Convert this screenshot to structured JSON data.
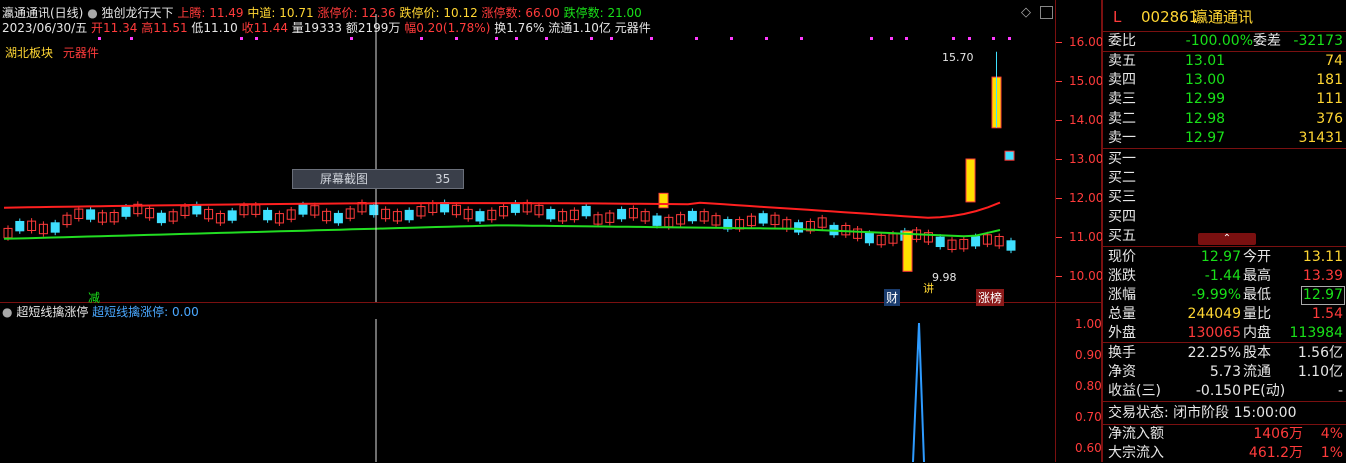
{
  "header": {
    "stock_name_period": "瀛通通讯(日线)",
    "indicator_name": "独创龙行天下",
    "upper_label": "上腾: 11.49",
    "mid_label": "中道: 10.71",
    "limit_up_label": "涨停价: 12.36",
    "limit_down_label": "跌停价: 10.12",
    "limit_up_count": "涨停数: 66.00",
    "limit_down_count": "跌停数: 21.00",
    "date": "2023/06/30/五",
    "open": "开11.34",
    "high": "高11.51",
    "low": "低11.10",
    "close": "收11.44",
    "volume": "量19333",
    "amount": "额2199万",
    "change": "幅0.20(1.78%)",
    "turnover": "换1.76%",
    "float": "流通1.10亿",
    "sector_tag": "元器件",
    "board_label": "湖北板块",
    "board_tag": "元器件"
  },
  "main_chart": {
    "y_axis": [
      "16.00",
      "15.00",
      "14.00",
      "13.00",
      "12.00",
      "11.00",
      "10.00"
    ],
    "annotation_high": "15.70",
    "annotation_low": "9.98",
    "markers": {
      "jian": "减",
      "cai": "财",
      "jiang": "讲",
      "zhangbang": "涨榜"
    },
    "screenshot_popup": {
      "label": "屏幕截图",
      "value": "35"
    },
    "colors": {
      "up": "#ff3b3b",
      "down": "#3fe0ff",
      "limit": "#ffe000",
      "ma_red": "#ff2020",
      "ma_green": "#22dd22"
    }
  },
  "indicator": {
    "title": "超短线擒涨停",
    "value_label": "超短线擒涨停: 0.00",
    "y_axis": [
      "1.00",
      "0.90",
      "0.80",
      "0.70",
      "0.60"
    ]
  },
  "panel": {
    "code": "002861",
    "name": "瀛通通讯",
    "flag": "L",
    "weibi_label": "委比",
    "weibi_value": "-100.00%",
    "weicha_label": "委差",
    "weicha_value": "-32173",
    "asks": [
      {
        "label": "卖五",
        "price": "13.01",
        "vol": "74"
      },
      {
        "label": "卖四",
        "price": "13.00",
        "vol": "181"
      },
      {
        "label": "卖三",
        "price": "12.99",
        "vol": "111"
      },
      {
        "label": "卖二",
        "price": "12.98",
        "vol": "376"
      },
      {
        "label": "卖一",
        "price": "12.97",
        "vol": "31431"
      }
    ],
    "bids": [
      {
        "label": "买一"
      },
      {
        "label": "买二"
      },
      {
        "label": "买三"
      },
      {
        "label": "买四"
      },
      {
        "label": "买五"
      }
    ],
    "stats": [
      {
        "l1": "现价",
        "v1": "12.97",
        "l2": "今开",
        "v2": "13.11"
      },
      {
        "l1": "涨跌",
        "v1": "-1.44",
        "l2": "最高",
        "v2": "13.39"
      },
      {
        "l1": "涨幅",
        "v1": "-9.99%",
        "l2": "最低",
        "v2": "12.97"
      },
      {
        "l1": "总量",
        "v1": "244049",
        "l2": "量比",
        "v2": "1.54"
      },
      {
        "l1": "外盘",
        "v1": "130065",
        "l2": "内盘",
        "v2": "113984"
      }
    ],
    "stats2": [
      {
        "l1": "换手",
        "v1": "22.25%",
        "l2": "股本",
        "v2": "1.56亿"
      },
      {
        "l1": "净资",
        "v1": "5.73",
        "l2": "流通",
        "v2": "1.10亿"
      },
      {
        "l1": "收益(三)",
        "v1": "-0.150",
        "l2": "PE(动)",
        "v2": "-"
      }
    ],
    "trade_status": "交易状态: 闭市阶段 15:00:00",
    "flows": [
      {
        "label": "净流入额",
        "value": "1406万",
        "pct": "4%"
      },
      {
        "label": "大宗流入",
        "value": "461.2万",
        "pct": "1%"
      }
    ]
  }
}
